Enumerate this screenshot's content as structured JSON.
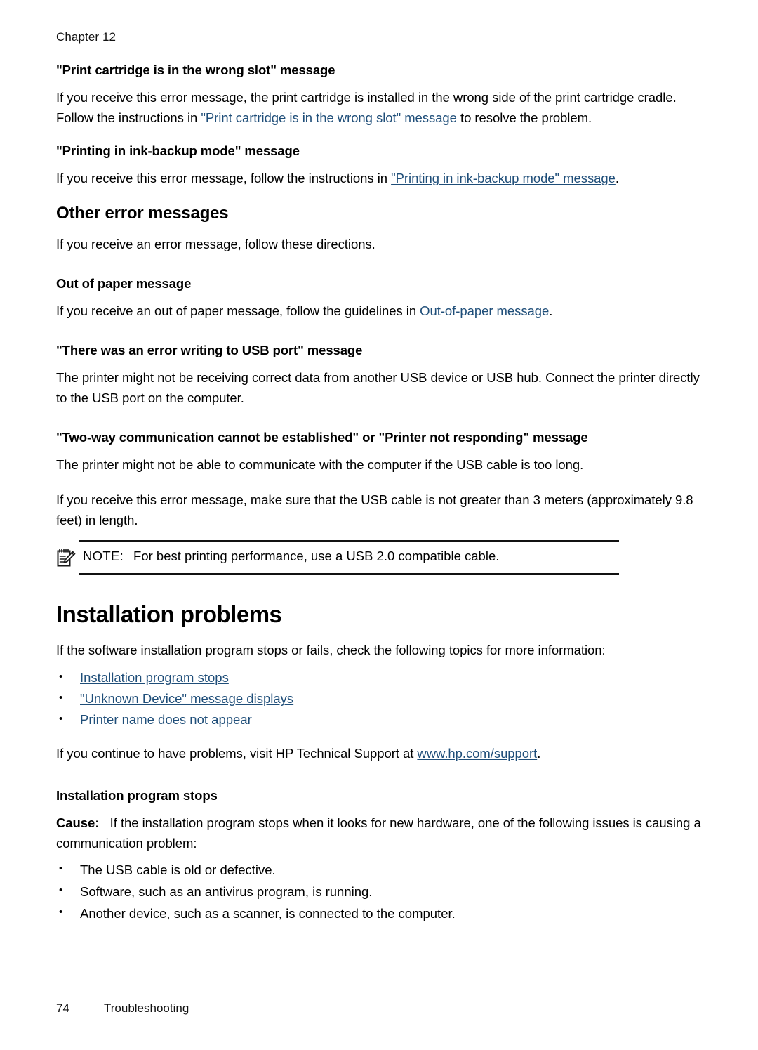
{
  "header": {
    "chapter_label": "Chapter 12"
  },
  "footer": {
    "page_number": "74",
    "section_name": "Troubleshooting"
  },
  "sections": {
    "wrong_slot": {
      "heading": "\"Print cartridge is in the wrong slot\" message",
      "body_before_link": "If you receive this error message, the print cartridge is installed in the wrong side of the print cartridge cradle. Follow the instructions in ",
      "link": "\"Print cartridge is in the wrong slot\" message",
      "body_after_link": " to resolve the problem."
    },
    "ink_backup": {
      "heading": "\"Printing in ink-backup mode\" message",
      "body_before_link": "If you receive this error message, follow the instructions in ",
      "link": "\"Printing in ink-backup mode\" message",
      "body_after_link": "."
    },
    "other_error_messages": {
      "heading": "Other error messages",
      "intro": "If you receive an error message, follow these directions."
    },
    "out_of_paper": {
      "heading": "Out of paper message",
      "body_before_link": "If you receive an out of paper message, follow the guidelines in ",
      "link": "Out-of-paper message",
      "body_after_link": "."
    },
    "usb_write_error": {
      "heading": "\"There was an error writing to USB port\" message",
      "body": "The printer might not be receiving correct data from another USB device or USB hub. Connect the printer directly to the USB port on the computer."
    },
    "two_way": {
      "heading": "\"Two-way communication cannot be established\" or \"Printer not responding\" message",
      "paragraph_1": "The printer might not be able to communicate with the computer if the USB cable is too long.",
      "paragraph_2": "If you receive this error message, make sure that the USB cable is not greater than 3 meters (approximately 9.8 feet) in length.",
      "note": {
        "icon": "note-pad-pencil-icon",
        "label": "NOTE:",
        "text": "For best printing performance, use a USB 2.0 compatible cable."
      }
    },
    "installation_problems": {
      "heading": "Installation problems",
      "intro": "If the software installation program stops or fails, check the following topics for more information:",
      "topic_links": [
        "Installation program stops",
        "\"Unknown Device\" message displays",
        "Printer name does not appear"
      ],
      "support_before_link": "If you continue to have problems, visit HP Technical Support at ",
      "support_link": "www.hp.com/support",
      "support_after_link": "."
    },
    "installation_program_stops": {
      "heading": "Installation program stops",
      "cause_label": "Cause:",
      "cause_text": "If the installation program stops when it looks for new hardware, one of the following issues is causing a communication problem:",
      "causes": [
        "The USB cable is old or defective.",
        "Software, such as an antivirus program, is running.",
        "Another device, such as a scanner, is connected to the computer."
      ]
    }
  },
  "colors": {
    "link": "#1f4e79",
    "text": "#000000",
    "rule": "#111111"
  }
}
